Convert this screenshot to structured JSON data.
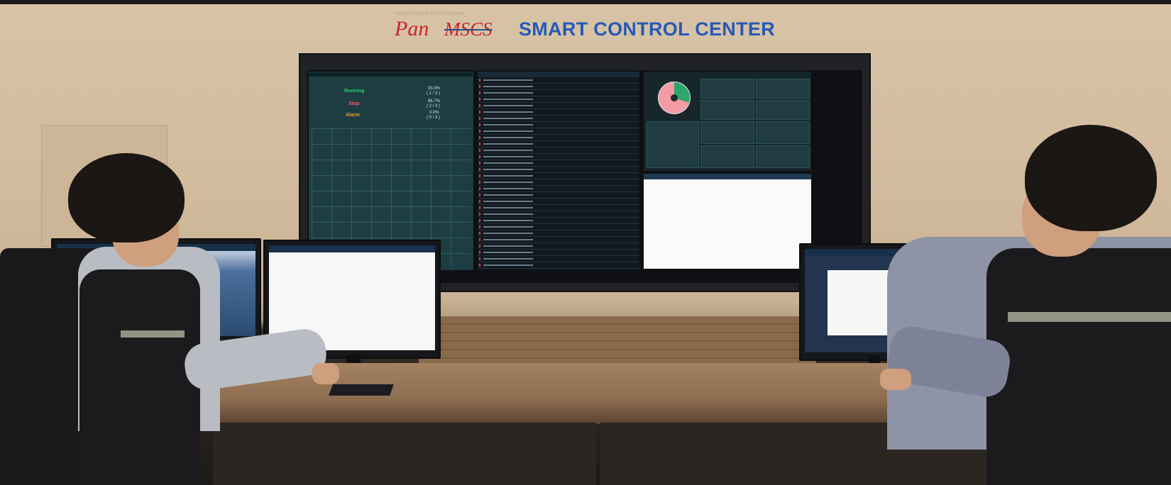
{
  "logo": {
    "tagline": "Pantos Satellite Control System",
    "brand_pan": "Pan",
    "brand_mscs": "MSCS",
    "title": "SMART CONTROL CENTER"
  },
  "videowall": {
    "status": {
      "running_label": "Running",
      "running_pct": "33.3%",
      "running_count": "( 1 / 3 )",
      "stop_label": "Stop",
      "stop_pct": "66.7%",
      "stop_count": "( 2 / 3 )",
      "alarm_label": "Alarm",
      "alarm_pct": "0.0%",
      "alarm_count": "( 0 / 3 )"
    },
    "colors": {
      "running": "#2ecc71",
      "stop": "#ff5a6e",
      "alarm": "#f0a020",
      "pie_green": "#2ea56a",
      "pie_pink": "#f39aa5"
    }
  }
}
